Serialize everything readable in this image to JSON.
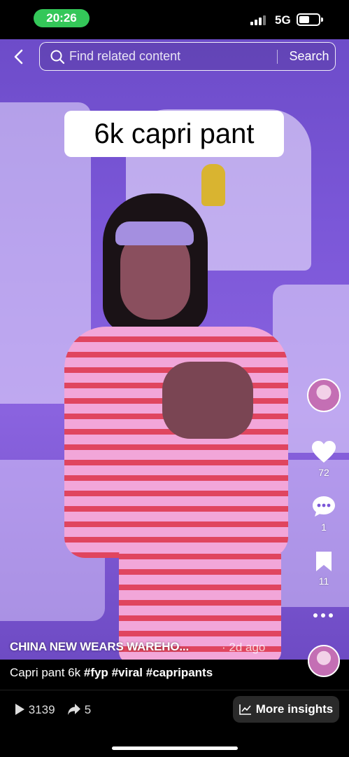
{
  "status_bar": {
    "time": "20:26",
    "network": "5G",
    "accent_color": "#34c759"
  },
  "search": {
    "placeholder": "Find related content",
    "button_label": "Search"
  },
  "video": {
    "overlay_caption": "6k capri pant"
  },
  "actions": {
    "likes": "72",
    "comments": "1",
    "saves": "11"
  },
  "post": {
    "author": "CHINA NEW WEARS WAREHO...",
    "date": "· 2d ago",
    "description_text": "Capri pant 6k",
    "hashtags": [
      "#fyp",
      "#viral",
      "#capripants"
    ]
  },
  "stats": {
    "views": "3139",
    "shares": "5",
    "insights_label": "More insights"
  },
  "icons": [
    "back-icon",
    "search-icon",
    "heart-icon",
    "comment-icon",
    "bookmark-icon",
    "more-icon",
    "play-icon",
    "share-icon",
    "chart-icon"
  ]
}
